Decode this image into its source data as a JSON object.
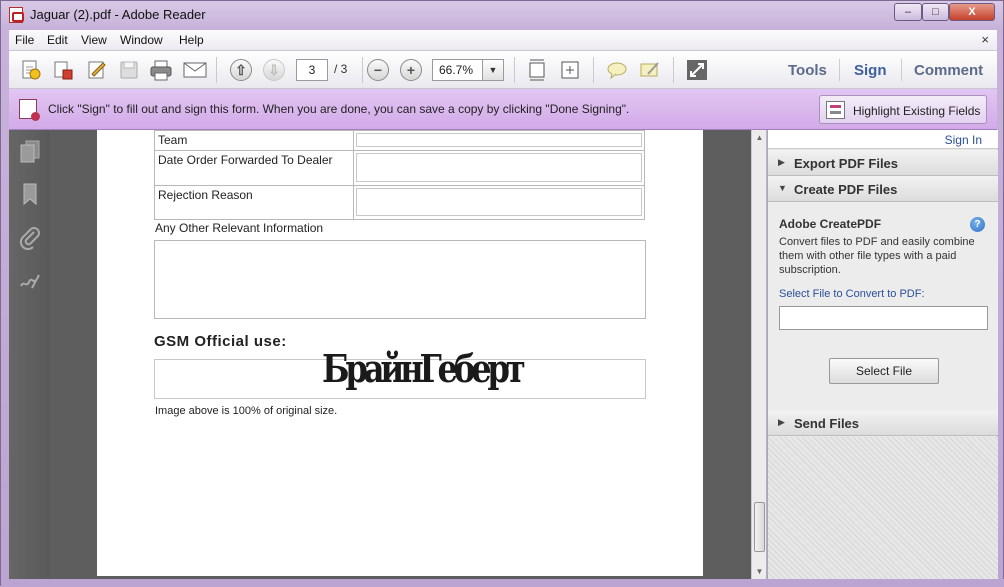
{
  "window": {
    "title": "Jaguar (2).pdf - Adobe Reader",
    "minimize": "–",
    "maximize": "□",
    "close": "X"
  },
  "menu": {
    "items": [
      "File",
      "Edit",
      "View",
      "Window",
      "Help"
    ],
    "close": "×"
  },
  "toolbar": {
    "page_current": "3",
    "page_total": "/ 3",
    "zoom": "66.7%",
    "zoom_arrow": "▼",
    "tabs": [
      "Tools",
      "Sign",
      "Comment"
    ]
  },
  "signbar": {
    "message": "Click \"Sign\" to fill out and sign this form. When you are done, you can save a copy by clicking \"Done Signing\".",
    "highlight_button": "Highlight Existing Fields"
  },
  "document": {
    "rows": [
      {
        "label": "Team"
      },
      {
        "label": "Date Order Forwarded To Dealer"
      },
      {
        "label": "Rejection Reason"
      }
    ],
    "other_info_label": "Any Other Relevant Information",
    "gsm_label": "GSM Official use:",
    "signature_text": "БрайнГеберт",
    "caption": "Image above is 100% of original size."
  },
  "rightpanel": {
    "sign_in": "Sign In",
    "export_title": "Export PDF Files",
    "create_title": "Create PDF Files",
    "createpdf_heading": "Adobe CreatePDF",
    "createpdf_desc": "Convert files to PDF and easily combine them with other file types with a paid subscription.",
    "select_label": "Select File to Convert to PDF:",
    "select_button": "Select File",
    "send_title": "Send Files",
    "arrow_collapsed": "▶",
    "arrow_expanded": "▼"
  },
  "colors": {
    "signbar": "#d9b6ee",
    "accent_link": "#2a4f9a",
    "doc_background": "#5e5e5e"
  }
}
